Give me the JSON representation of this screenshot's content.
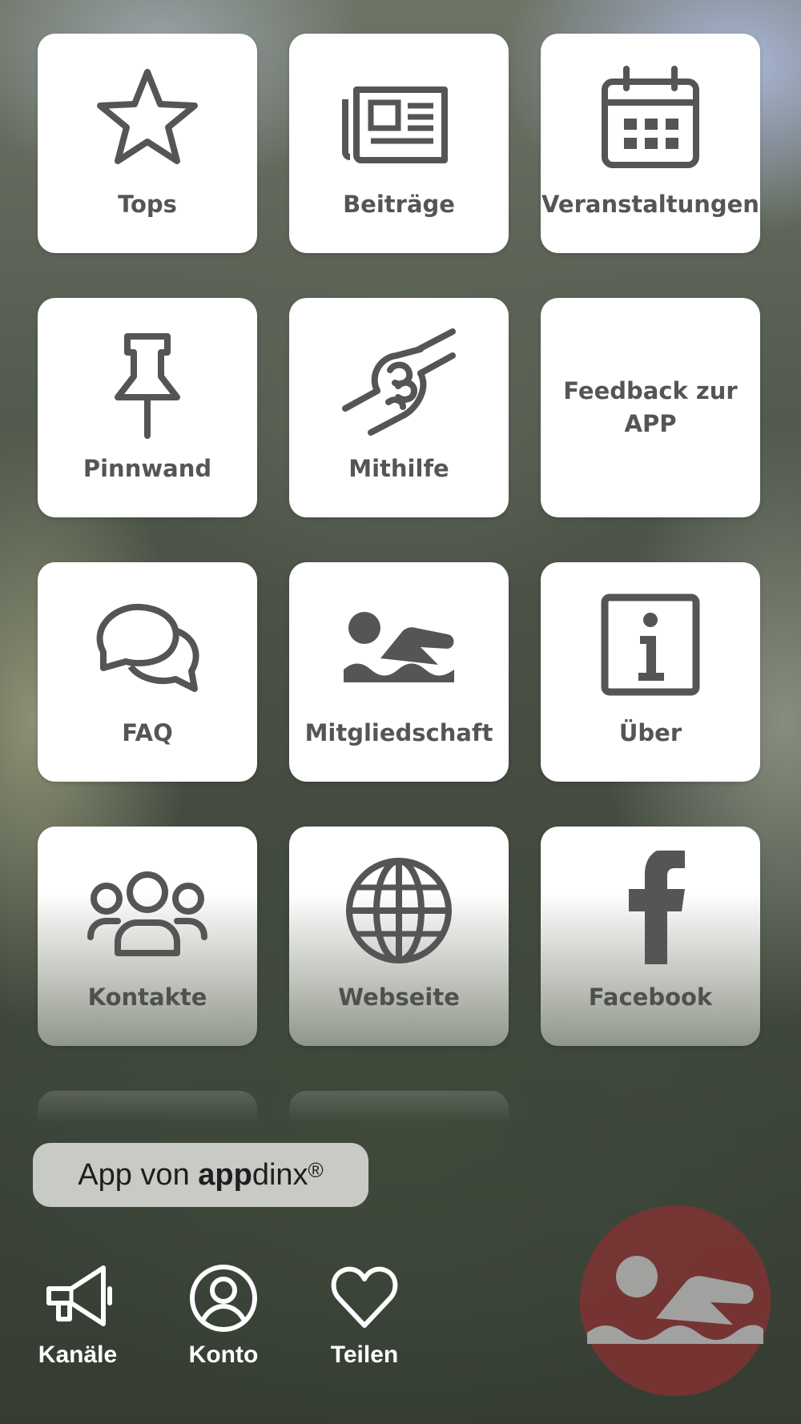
{
  "tiles": [
    {
      "label": "Tops",
      "icon": "star-icon"
    },
    {
      "label": "Beiträge",
      "icon": "newspaper-icon"
    },
    {
      "label": "Veranstaltungen",
      "icon": "calendar-icon"
    },
    {
      "label": "Pinnwand",
      "icon": "pushpin-icon"
    },
    {
      "label": "Mithilfe",
      "icon": "handshake-icon"
    },
    {
      "label": "Feedback zur APP",
      "icon": ""
    },
    {
      "label": "FAQ",
      "icon": "chat-bubbles-icon"
    },
    {
      "label": "Mitgliedschaft",
      "icon": "swimmer-icon"
    },
    {
      "label": "Über",
      "icon": "info-icon"
    },
    {
      "label": "Kontakte",
      "icon": "people-icon"
    },
    {
      "label": "Webseite",
      "icon": "globe-icon"
    },
    {
      "label": "Facebook",
      "icon": "facebook-icon"
    }
  ],
  "brand": {
    "prefix": "App von ",
    "bold": "app",
    "rest": "dinx",
    "mark": "®"
  },
  "nav": [
    {
      "label": "Kanäle",
      "icon": "megaphone-icon"
    },
    {
      "label": "Konto",
      "icon": "account-icon"
    },
    {
      "label": "Teilen",
      "icon": "heart-icon"
    }
  ],
  "fab": {
    "icon": "swimmer-icon",
    "color": "#7a3432"
  },
  "colors": {
    "tile_bg": "#ffffff",
    "icon_gray": "#555555",
    "nav_text": "#ffffff"
  }
}
